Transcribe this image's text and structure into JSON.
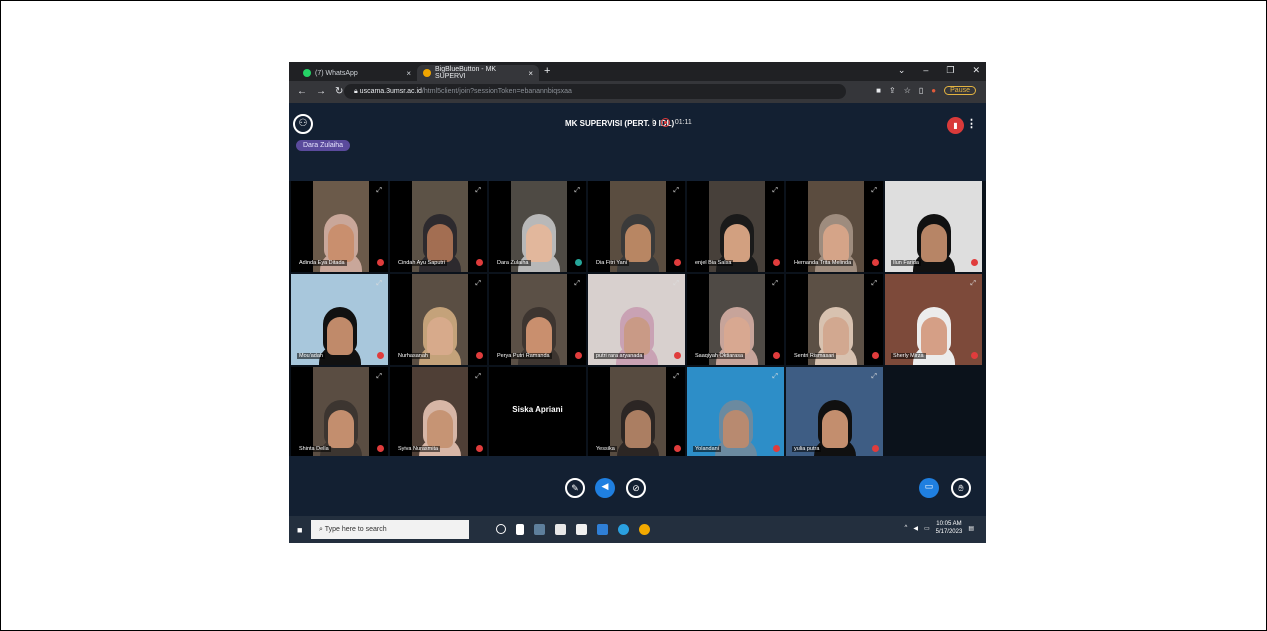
{
  "browser": {
    "tabs": [
      {
        "label": "(7) WhatsApp",
        "icon": "whatsapp-icon",
        "color": "#25d366"
      },
      {
        "label": "BigBlueButton - MK SUPERVI",
        "icon": "bigbluebutton-icon",
        "color": "#f0a500"
      }
    ],
    "new_tab": "+",
    "url_host": "uscama.3umsr.ac.id",
    "url_path": "/html5client/join?sessionToken=ebanannbiqsxaa",
    "pause_label": "Pause"
  },
  "meeting": {
    "title": "MK SUPERVISI (PERT. 9 IDL)",
    "elapsed": "01:11",
    "talking": "Dara Zulaiha"
  },
  "participants": [
    {
      "name": "Adinda Eya Ditada",
      "mic": "muted",
      "bg": "#6b5a4a",
      "skin": "#c98f6e",
      "hijab": "#c9a79a"
    },
    {
      "name": "Cindah Ayu Saputri",
      "mic": "muted",
      "bg": "#5c5246",
      "skin": "#a36e52",
      "hijab": "#2d2a2e"
    },
    {
      "name": "Dara Zulaiha",
      "mic": "on",
      "bg": "#4e4a44",
      "skin": "#e2b79c",
      "hijab": "#b8b8b8"
    },
    {
      "name": "Dia Fitri Yani",
      "mic": "muted",
      "bg": "#5a4d40",
      "skin": "#b88663",
      "hijab": "#3a3a3a"
    },
    {
      "name": "enjel Bia Salsa",
      "mic": "muted",
      "bg": "#47403a",
      "skin": "#d2a080",
      "hijab": "#1a1a1a"
    },
    {
      "name": "Hernanda Trita Melinda",
      "mic": "muted",
      "bg": "#5b4c3f",
      "skin": "#d5a488",
      "hijab": "#9e8c7e"
    },
    {
      "name": "Ilun Farida",
      "mic": "muted",
      "bg": "#dedede",
      "skin": "#b78566",
      "hijab": "#111111"
    },
    {
      "name": "Mou'adah",
      "mic": "muted",
      "bg": "#a8c7dc",
      "skin": "#c08a6a",
      "hijab": "#111111"
    },
    {
      "name": "Nurhasanah",
      "mic": "muted",
      "bg": "#5a4e43",
      "skin": "#d7aa8b",
      "hijab": "#c4a27a"
    },
    {
      "name": "Perya Putri Ramanda",
      "mic": "muted",
      "bg": "#5b5046",
      "skin": "#c98f6e",
      "hijab": "#3d3530"
    },
    {
      "name": "putri rara aryanada",
      "mic": "muted",
      "bg": "#d8d0ce",
      "skin": "#c99a86",
      "hijab": "#c9a2b4"
    },
    {
      "name": "Saaqiyah Oktiarasa",
      "mic": "muted",
      "bg": "#4f4a45",
      "skin": "#d8a891",
      "hijab": "#c7a49a"
    },
    {
      "name": "Sentri Rismasari",
      "mic": "muted",
      "bg": "#5c5045",
      "skin": "#d2a890",
      "hijab": "#d8c2b0"
    },
    {
      "name": "Sherly Mirza",
      "mic": "muted",
      "bg": "#7d4a3a",
      "skin": "#d59f86",
      "hijab": "#ececec"
    },
    {
      "name": "Shinta Della",
      "mic": "muted",
      "bg": "#5a4d42",
      "skin": "#c38e6e",
      "hijab": "#3c3530"
    },
    {
      "name": "Syiva Nurasmita",
      "mic": "muted",
      "bg": "#4f3f36",
      "skin": "#c69474",
      "hijab": "#d7b6a6"
    },
    {
      "name": "Siska Apriani",
      "mic": "none",
      "bg": "#0b121b",
      "skin": "",
      "hijab": ""
    },
    {
      "name": "Yessika",
      "mic": "muted",
      "bg": "#574b40",
      "skin": "#ab7e62",
      "hijab": "#2c2624"
    },
    {
      "name": "Yolandani",
      "mic": "muted",
      "bg": "#2d8ec8",
      "skin": "#b88a70",
      "hijab": "#6b8aa0"
    },
    {
      "name": "yulia putra",
      "mic": "muted",
      "bg": "#3e5d84",
      "skin": "#c38e6e",
      "hijab": "#101010"
    }
  ],
  "actions": {
    "mic_icon": "mic-off-icon",
    "audio_icon": "audio-icon",
    "camera_icon": "camera-off-icon",
    "share_icon": "screen-share-icon",
    "raise_hand_icon": "raise-hand-icon"
  },
  "taskbar": {
    "search_placeholder": "Type here to search",
    "time": "10:05 AM",
    "date": "5/17/2023"
  }
}
